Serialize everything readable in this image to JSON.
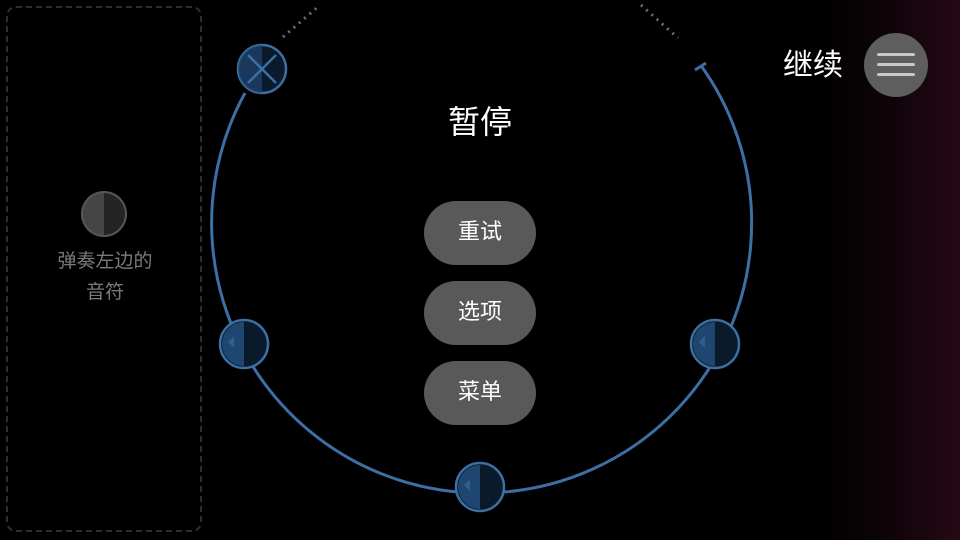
{
  "hint": {
    "text": "弹奏左边的\n音符"
  },
  "pause_menu": {
    "title": "暂停",
    "retry_label": "重试",
    "options_label": "选项",
    "menu_label": "菜单"
  },
  "top_right": {
    "continue_label": "继续",
    "menu_icon": "hamburger-icon"
  },
  "colors": {
    "ring": "#3c6fa3",
    "note_fill": "#0a1a2a",
    "note_half": "#1f4670",
    "button_bg": "#595959",
    "hint_text": "#7a7a7a"
  },
  "icons": {
    "crossed_note": "x-mark-icon",
    "half_note": "half-circle-note-icon"
  }
}
